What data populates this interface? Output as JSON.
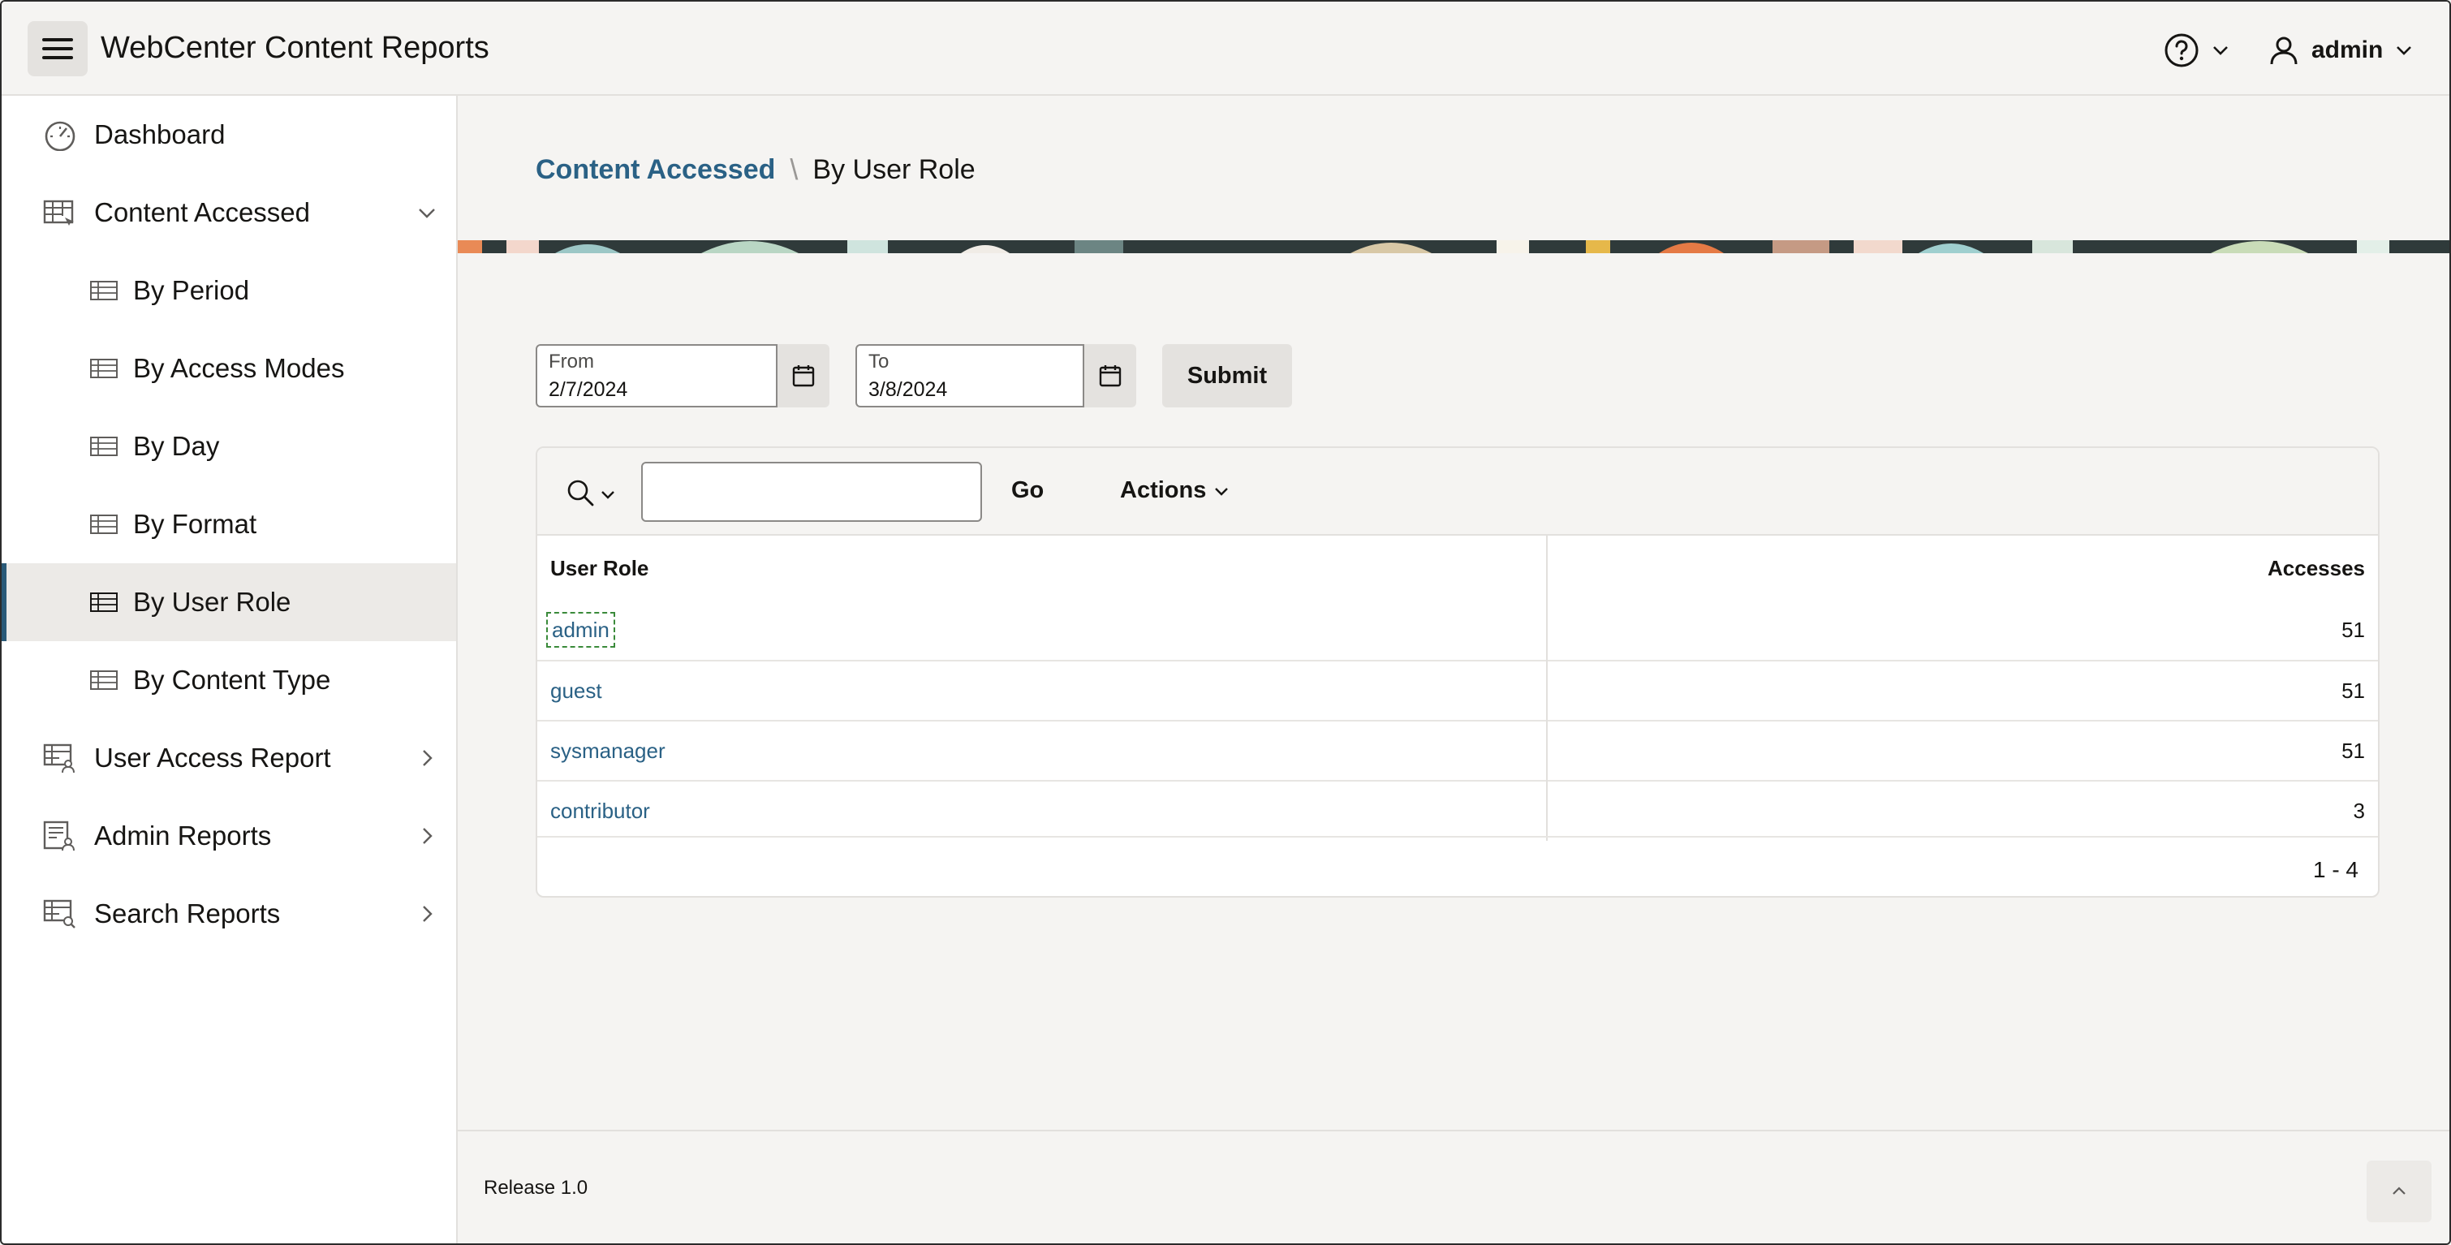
{
  "header": {
    "app_title": "WebCenter Content Reports",
    "user_name": "admin"
  },
  "sidebar": {
    "items": [
      {
        "label": "Dashboard",
        "icon": "dashboard-icon"
      },
      {
        "label": "Content Accessed",
        "icon": "report-icon",
        "expanded": true
      },
      {
        "label": "By Period",
        "icon": "table-icon"
      },
      {
        "label": "By Access Modes",
        "icon": "table-icon"
      },
      {
        "label": "By Day",
        "icon": "table-icon"
      },
      {
        "label": "By Format",
        "icon": "table-icon"
      },
      {
        "label": "By User Role",
        "icon": "table-icon",
        "active": true
      },
      {
        "label": "By Content Type",
        "icon": "table-icon"
      },
      {
        "label": "User Access Report",
        "icon": "user-report-icon"
      },
      {
        "label": "Admin Reports",
        "icon": "admin-report-icon"
      },
      {
        "label": "Search Reports",
        "icon": "search-report-icon"
      }
    ]
  },
  "breadcrumb": {
    "parent": "Content Accessed",
    "separator": "\\",
    "current": "By User Role"
  },
  "filters": {
    "from_label": "From",
    "from_value": "2/7/2024",
    "to_label": "To",
    "to_value": "3/8/2024",
    "submit_label": "Submit"
  },
  "report": {
    "search_value": "",
    "go_label": "Go",
    "actions_label": "Actions",
    "columns": [
      "User Role",
      "Accesses"
    ],
    "rows": [
      {
        "role": "admin",
        "accesses": "51"
      },
      {
        "role": "guest",
        "accesses": "51"
      },
      {
        "role": "sysmanager",
        "accesses": "51"
      },
      {
        "role": "contributor",
        "accesses": "3"
      }
    ],
    "pagination": "1 - 4"
  },
  "footer": {
    "release": "Release 1.0"
  },
  "colors": {
    "accent_link": "#2a6185",
    "active_bar": "#2a5a78",
    "background": "#f5f4f2"
  }
}
